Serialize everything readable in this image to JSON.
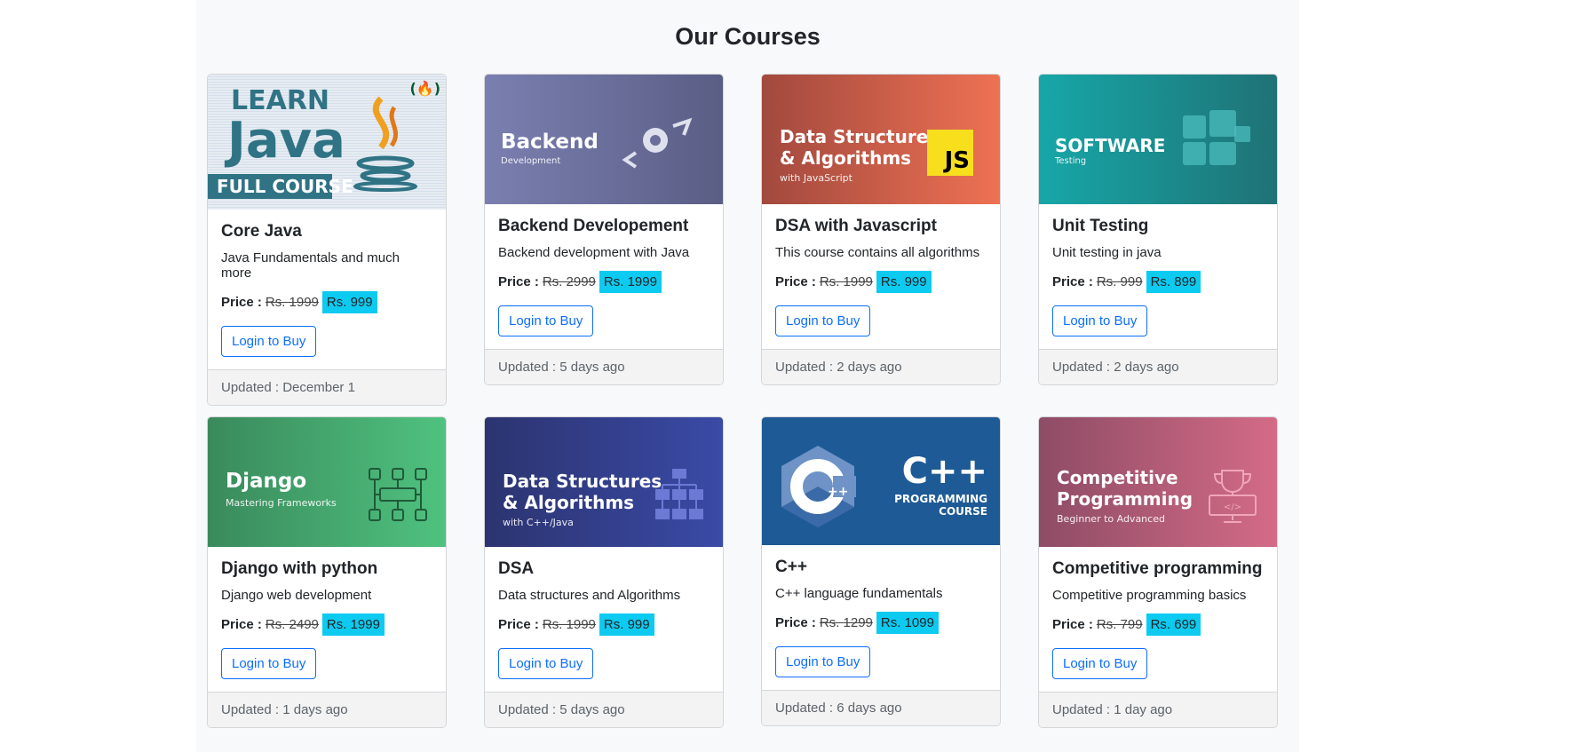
{
  "heading": "Our Courses",
  "price_label": "Price :",
  "button_label": "Login to Buy",
  "courses": [
    {
      "title": "Core Java",
      "description": "Java Fundamentals and much more",
      "old_price": "Rs. 1999",
      "new_price": "Rs. 999",
      "updated": "Updated : December 1",
      "banner": {
        "line1": "LEARN",
        "line2": "Java",
        "line3": "FULL COURSE",
        "bg": "#d9e3ee",
        "accent": "#2f7385"
      }
    },
    {
      "title": "Backend Developement",
      "description": "Backend development with Java",
      "old_price": "Rs. 2999",
      "new_price": "Rs. 1999",
      "updated": "Updated : 5 days ago",
      "banner": {
        "line1": "Backend",
        "line2": "Development",
        "bg_from": "#7b7fb0",
        "bg_to": "#5a5e85",
        "icon": "gear-icon"
      }
    },
    {
      "title": "DSA with Javascript",
      "description": "This course contains all algorithms",
      "old_price": "Rs. 1999",
      "new_price": "Rs. 999",
      "updated": "Updated : 2 days ago",
      "banner": {
        "line1": "Data Structures",
        "line1b": "& Algorithms",
        "line2": "with JavaScript",
        "badge": "JS",
        "bg_from": "#a2493e",
        "bg_to": "#ee7153"
      }
    },
    {
      "title": "Unit Testing",
      "description": "Unit testing in java",
      "old_price": "Rs. 999",
      "new_price": "Rs. 899",
      "updated": "Updated : 2 days ago",
      "banner": {
        "line1": "SOFTWARE",
        "line2": "Testing",
        "bg_from": "#17a7a8",
        "bg_to": "#1f7275"
      }
    },
    {
      "title": "Django with python",
      "description": "Django web development",
      "old_price": "Rs. 2499",
      "new_price": "Rs. 1999",
      "updated": "Updated : 1 days ago",
      "banner": {
        "line1": "Django",
        "line2": "Mastering Frameworks",
        "bg_from": "#3a8a5c",
        "bg_to": "#4fc27f"
      }
    },
    {
      "title": "DSA",
      "description": "Data structures and Algorithms",
      "old_price": "Rs. 1999",
      "new_price": "Rs. 999",
      "updated": "Updated : 5 days ago",
      "banner": {
        "line1": "Data Structures",
        "line1b": "& Algorithms",
        "line2": "with C++/Java",
        "bg_from": "#2c3470",
        "bg_to": "#3a4aa6"
      }
    },
    {
      "title": "C++",
      "description": "C++ language fundamentals",
      "old_price": "Rs. 1299",
      "new_price": "Rs. 1099",
      "updated": "Updated : 6 days ago",
      "banner": {
        "line1": "C++",
        "line2": "PROGRAMMING",
        "line3": "COURSE",
        "bg": "#1e5a96"
      }
    },
    {
      "title": "Competitive programming",
      "description": "Competitive programming basics",
      "old_price": "Rs. 799",
      "new_price": "Rs. 699",
      "updated": "Updated : 1 day ago",
      "banner": {
        "line1": "Competitive",
        "line1b": "Programming",
        "line2": "Beginner to Advanced",
        "bg_from": "#8e4c65",
        "bg_to": "#d46b87"
      }
    }
  ]
}
